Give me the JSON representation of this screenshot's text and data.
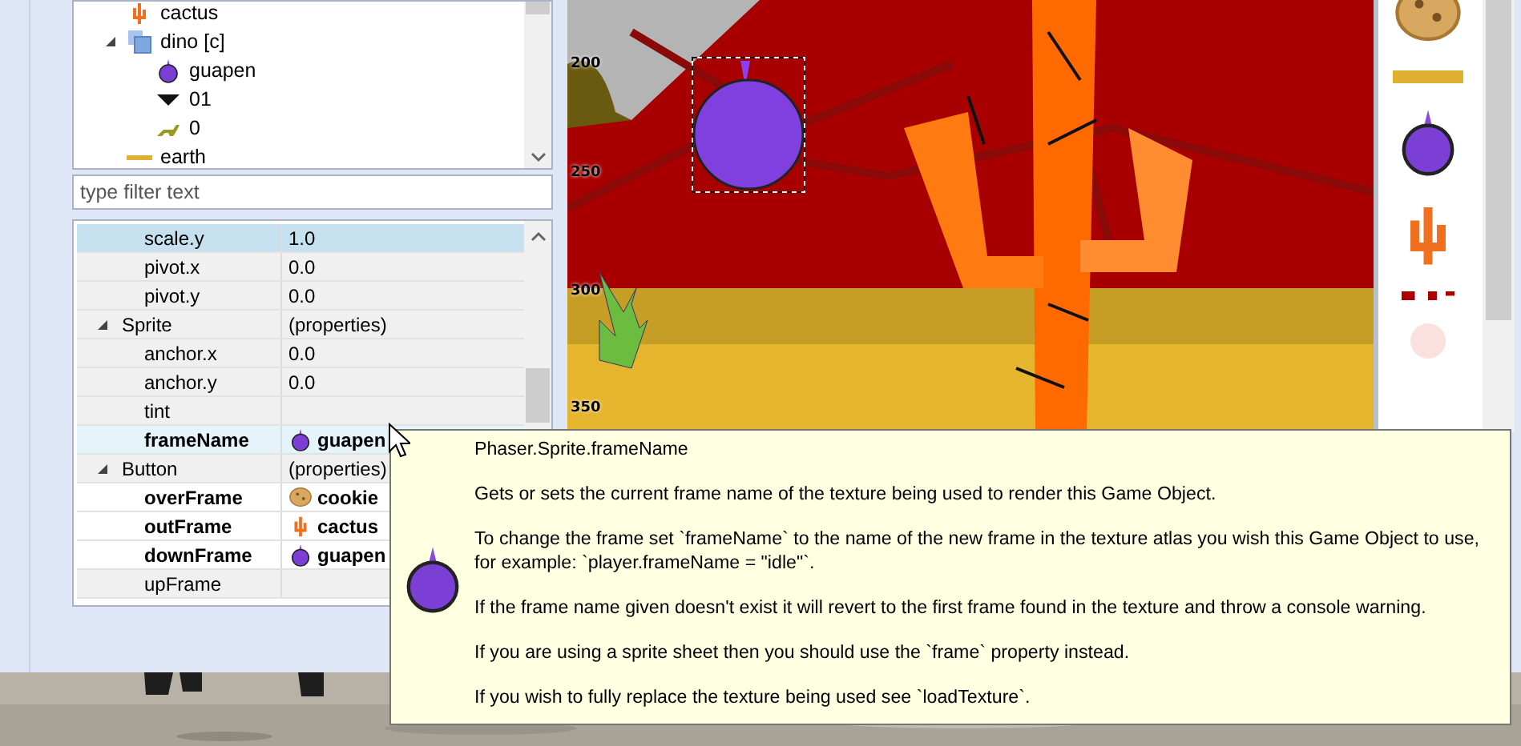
{
  "outline": {
    "items": [
      {
        "label": "cactus",
        "kind": "cactus"
      },
      {
        "label": "dino [c]",
        "kind": "group",
        "expanded": true,
        "children": [
          {
            "label": "guapen",
            "kind": "fruit"
          },
          {
            "label": "01",
            "kind": "chevron"
          },
          {
            "label": "0",
            "kind": "dino"
          }
        ]
      },
      {
        "label": "earth",
        "kind": "strip"
      }
    ]
  },
  "filter": {
    "placeholder": "type filter text"
  },
  "properties": {
    "rows": [
      {
        "kind": "property",
        "name": "scale.y",
        "value": "1.0",
        "modified": false,
        "selected": true
      },
      {
        "kind": "property",
        "name": "pivot.x",
        "value": "0.0",
        "modified": false,
        "selected": false
      },
      {
        "kind": "property",
        "name": "pivot.y",
        "value": "0.0",
        "modified": false,
        "selected": false
      },
      {
        "kind": "group",
        "name": "Sprite",
        "value": "(properties)",
        "expanded": true
      },
      {
        "kind": "property",
        "name": "anchor.x",
        "value": "0.0",
        "modified": false,
        "selected": false
      },
      {
        "kind": "property",
        "name": "anchor.y",
        "value": "0.0",
        "modified": false,
        "selected": false
      },
      {
        "kind": "property",
        "name": "tint",
        "modified": false,
        "selected": false
      },
      {
        "kind": "property",
        "name": "frameName",
        "value": "guapen",
        "sprite": {
          "kind": "fruit"
        },
        "modified": true,
        "selected": false,
        "hovered": true
      },
      {
        "kind": "group",
        "name": "Button",
        "value": "(properties)",
        "expanded": true
      },
      {
        "kind": "property",
        "name": "overFrame",
        "value": "cookie",
        "sprite": {
          "kind": "cookie"
        },
        "modified": true,
        "selected": false
      },
      {
        "kind": "property",
        "name": "outFrame",
        "value": "cactus",
        "sprite": {
          "kind": "cactus"
        },
        "modified": true,
        "selected": false
      },
      {
        "kind": "property",
        "name": "downFrame",
        "value": "guapen",
        "sprite": {
          "kind": "fruit"
        },
        "modified": true,
        "selected": false
      },
      {
        "kind": "property",
        "name": "upFrame",
        "modified": false,
        "selected": false
      }
    ]
  },
  "scene": {
    "ruler_labels": [
      "200",
      "250",
      "300",
      "350"
    ]
  },
  "palette": {
    "items": [
      {
        "kind": "cookie"
      },
      {
        "kind": "strip"
      },
      {
        "kind": "fruit"
      },
      {
        "kind": "cactus"
      },
      {
        "kind": "speck"
      },
      {
        "kind": "blob"
      }
    ]
  },
  "tooltip": {
    "title": "Phaser.Sprite.frameName",
    "paragraphs": [
      "Gets or sets the current frame name of the texture being used to render this Game Object.",
      "To change the frame set `frameName` to the name of the new frame in the texture atlas you wish this Game Object to use, for example: `player.frameName = \"idle\"`.",
      "If the frame name given doesn't exist it will revert to the first frame found in the texture and throw a console warning.",
      "If you are using a sprite sheet then you should use the `frame` property instead.",
      "If you wish to fully replace the texture being used see `loadTexture`."
    ]
  }
}
